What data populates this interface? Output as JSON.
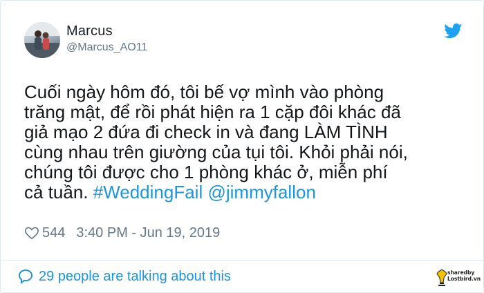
{
  "user": {
    "name": "Marcus",
    "handle": "@Marcus_AO11"
  },
  "tweet": {
    "text_plain": "Cuối ngày hôm đó, tôi bế vợ mình vào phòng\ntrăng mật, để rồi phát hiện ra 1 cặp đôi khác đã\ngiả mạo 2 đứa đi check in và đang LÀM TÌNH\ncùng nhau trên giường của tụi tôi. Khỏi phải nói,\nchúng tôi được cho 1 phòng khác ở, miễn phí\ncả tuần. ",
    "hashtag": "#WeddingFail",
    "mention": "@jimmyfallon"
  },
  "meta": {
    "likes": "544",
    "timestamp": "3:40 PM - Jun 19, 2019"
  },
  "footer": {
    "talking_label": "29 people are talking about this"
  },
  "watermark": {
    "line1": "sharedby",
    "line2": "Lostbird.vn"
  },
  "icons": {
    "twitter": "twitter-bird-icon",
    "like": "heart-icon",
    "reply": "speech-bubble-icon"
  },
  "colors": {
    "link": "#1b95e0",
    "muted": "#657786",
    "twitter_blue": "#1da1f2",
    "text": "#14171a"
  }
}
